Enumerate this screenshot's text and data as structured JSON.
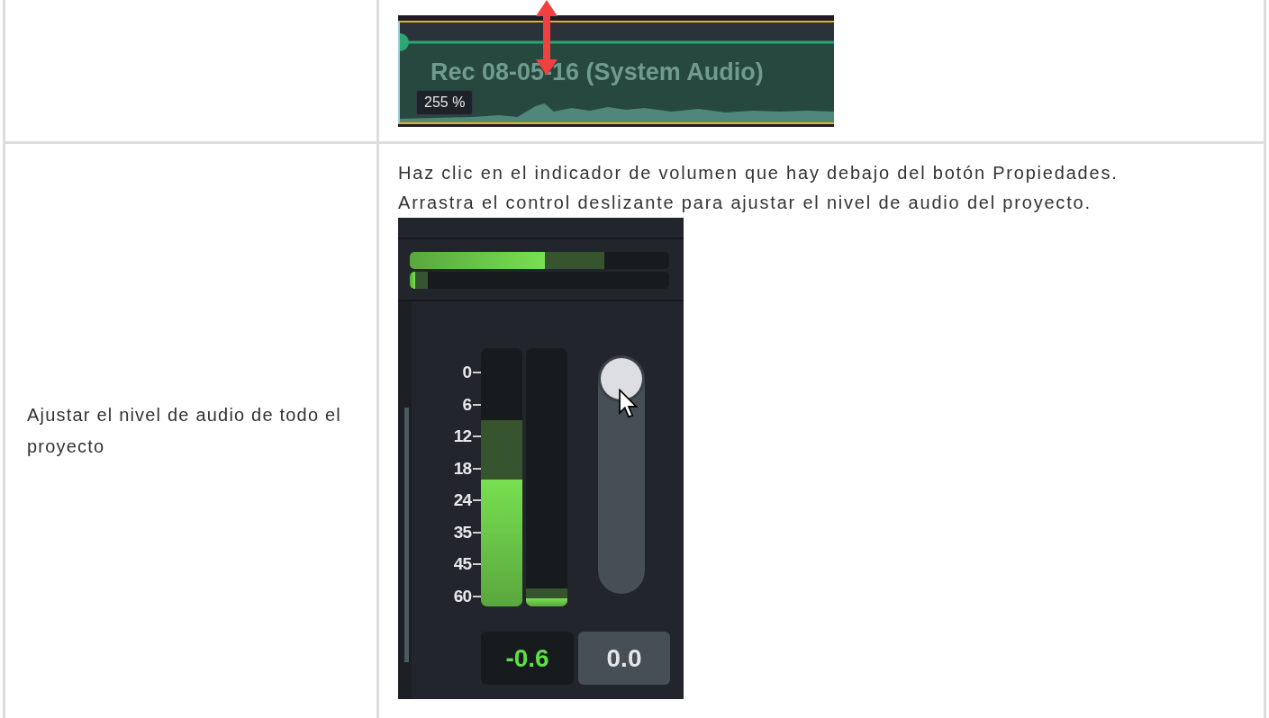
{
  "top_row": {
    "clip": {
      "title": "Rec 08-05-16 (System Audio)",
      "volume_tooltip": "255 %"
    }
  },
  "volume_row": {
    "label": "Ajustar el nivel de audio de todo el proyecto",
    "instructions": [
      "Haz clic en el indicador de volumen que hay debajo del botón Propiedades.",
      "Arrastra el control deslizante para ajustar el nivel de audio del proyecto."
    ],
    "mixer": {
      "horizontal_meters": [
        {
          "fill": {
            "level": 0.52
          },
          "peak": {
            "level": 0.75
          }
        },
        {
          "fill": {
            "level": 0.02
          },
          "peak": {
            "level": 0.07
          }
        }
      ],
      "scale": [
        "0",
        "6",
        "12",
        "18",
        "24",
        "35",
        "45",
        "60"
      ],
      "vertical_meters": [
        {
          "fill": {
            "level": 0.49
          },
          "peak": {
            "level": 0.72
          }
        },
        {
          "fill": {
            "level": 0.03
          },
          "peak": {
            "level": 0.07
          }
        }
      ],
      "volume_slider": {
        "level": 0.93
      },
      "peak_reading": "-0.6",
      "volume_reading": "0.0"
    }
  }
}
